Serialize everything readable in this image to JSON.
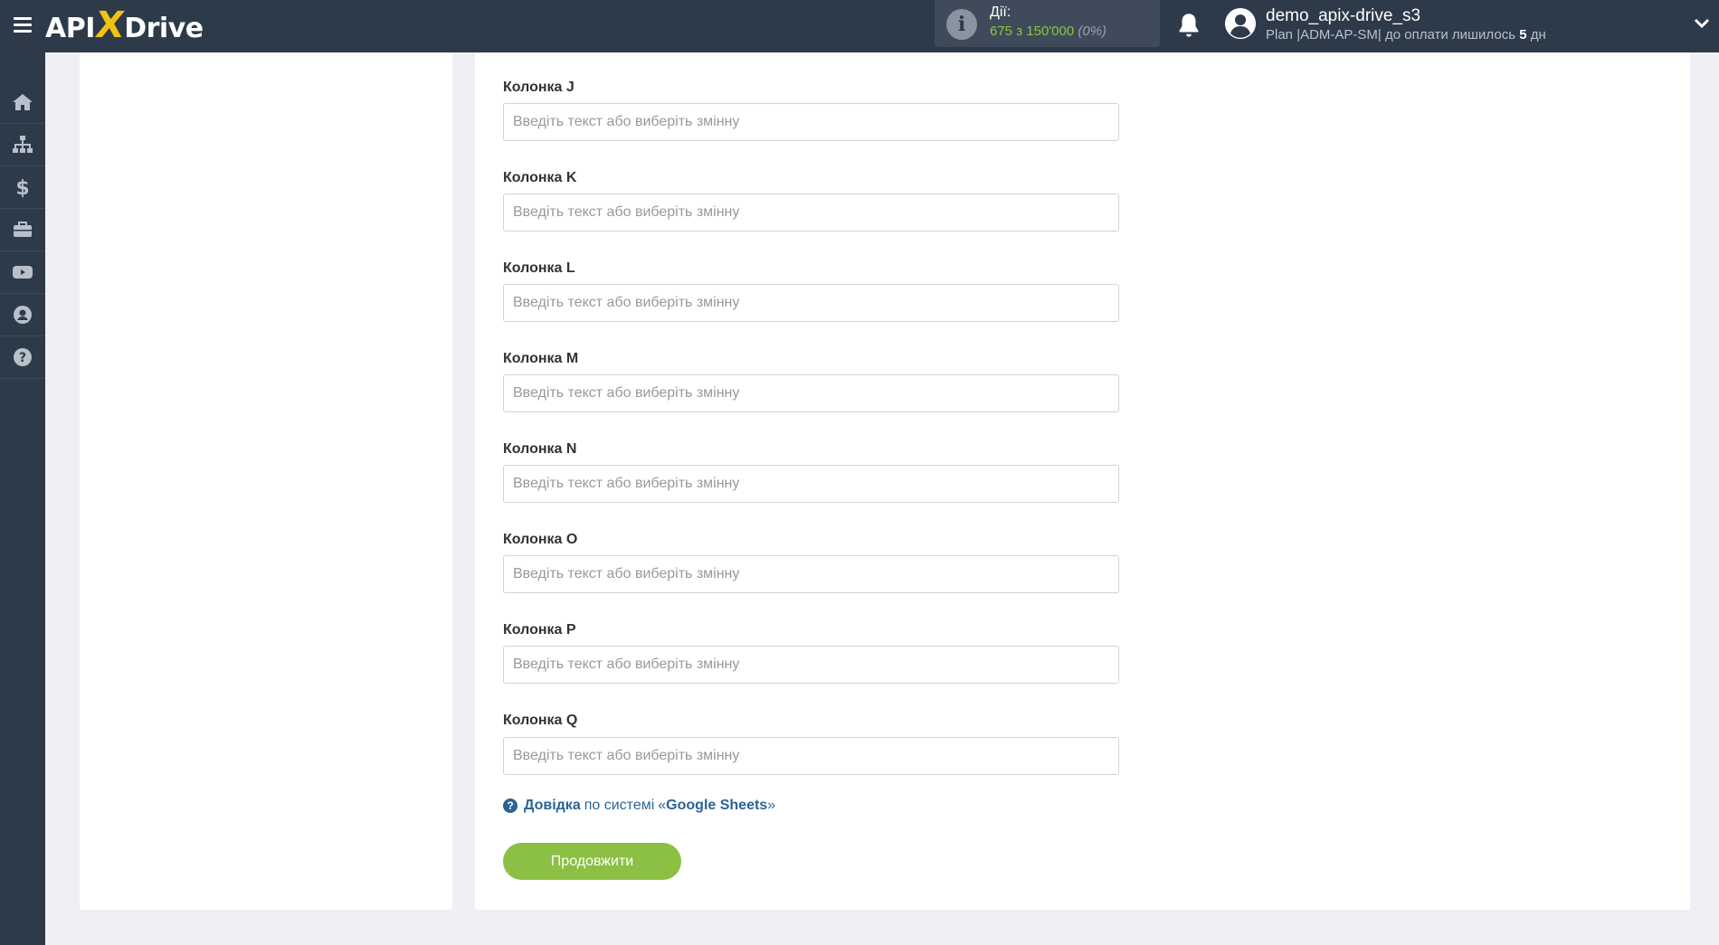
{
  "header": {
    "logo_left": "API",
    "logo_x": "X",
    "logo_right": "Drive",
    "actions_label": "Дії:",
    "actions_used": "675",
    "actions_of": "з",
    "actions_total": "150'000",
    "actions_percent": "(0%)",
    "user_name": "demo_apix-drive_s3",
    "plan_text": "Plan |ADM-AP-SM| до оплати лишилось",
    "plan_days": "5",
    "plan_days_unit": "дн"
  },
  "sidebar": {
    "items": [
      {
        "icon": "home-icon"
      },
      {
        "icon": "sitemap-icon"
      },
      {
        "icon": "dollar-icon"
      },
      {
        "icon": "briefcase-icon"
      },
      {
        "icon": "youtube-icon"
      },
      {
        "icon": "user-circle-icon"
      },
      {
        "icon": "help-circle-icon"
      }
    ]
  },
  "form": {
    "placeholder": "Введіть текст або виберіть змінну",
    "fields": [
      {
        "label": "Колонка J",
        "value": ""
      },
      {
        "label": "Колонка K",
        "value": ""
      },
      {
        "label": "Колонка L",
        "value": ""
      },
      {
        "label": "Колонка M",
        "value": ""
      },
      {
        "label": "Колонка N",
        "value": ""
      },
      {
        "label": "Колонка O",
        "value": ""
      },
      {
        "label": "Колонка P",
        "value": ""
      },
      {
        "label": "Колонка Q",
        "value": ""
      }
    ],
    "help_link": "Довідка",
    "help_mid": "по системі",
    "help_open_quote": "«",
    "help_service": "Google Sheets",
    "help_close_quote": "»",
    "continue_label": "Продовжити"
  },
  "colors": {
    "topbar": "#2d3a4a",
    "accent_green": "#8cc044",
    "link_blue": "#2a6496",
    "logo_yellow": "#f2c210"
  }
}
